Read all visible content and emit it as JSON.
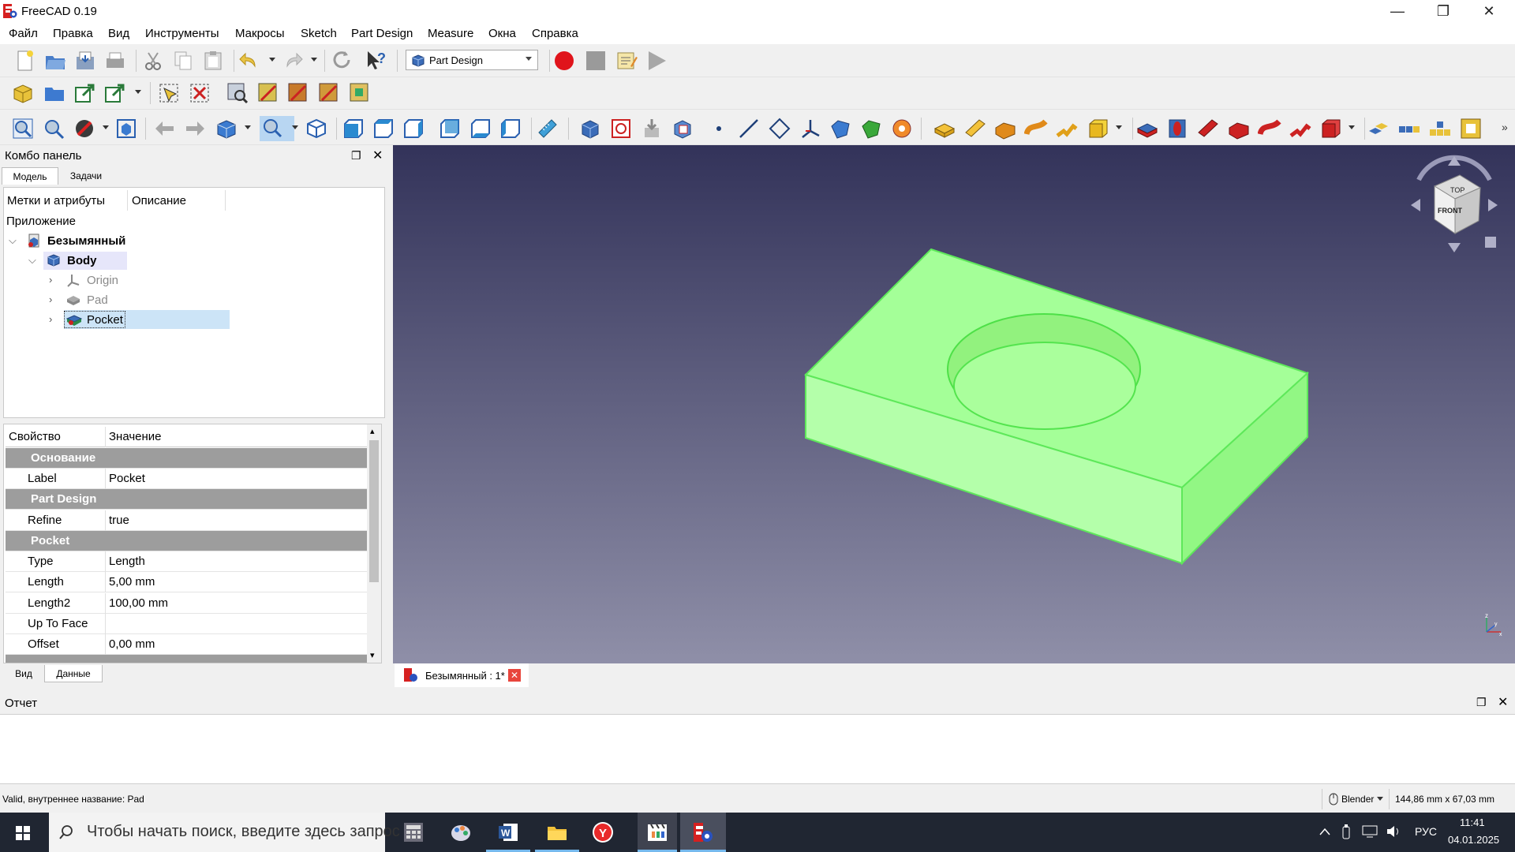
{
  "window": {
    "title": "FreeCAD 0.19",
    "minimize": "—",
    "restore": "❐",
    "close": "✕"
  },
  "menu": [
    "Файл",
    "Правка",
    "Вид",
    "Инструменты",
    "Макросы",
    "Sketch",
    "Part Design",
    "Measure",
    "Окна",
    "Справка"
  ],
  "toolbar": {
    "workbench_selected": "Part Design"
  },
  "combo": {
    "title": "Комбо панель",
    "tabs": [
      "Модель",
      "Задачи"
    ],
    "tree_headers": [
      "Метки и атрибуты",
      "Описание"
    ],
    "app_label": "Приложение",
    "tree": [
      {
        "label": "Безымянный",
        "icon": "document-icon"
      },
      {
        "label": "Body",
        "icon": "body-icon"
      },
      {
        "label": "Origin",
        "icon": "origin-icon"
      },
      {
        "label": "Pad",
        "icon": "pad-icon"
      },
      {
        "label": "Pocket",
        "icon": "pocket-icon"
      }
    ],
    "props_headers": [
      "Свойство",
      "Значение"
    ],
    "props": [
      {
        "group": "Основание"
      },
      {
        "key": "Label",
        "value": "Pocket"
      },
      {
        "group": "Part Design"
      },
      {
        "key": "Refine",
        "value": "true"
      },
      {
        "group": "Pocket"
      },
      {
        "key": "Type",
        "value": "Length"
      },
      {
        "key": "Length",
        "value": "5,00 mm"
      },
      {
        "key": "Length2",
        "value": "100,00 mm"
      },
      {
        "key": "Up To Face",
        "value": ""
      },
      {
        "key": "Offset",
        "value": "0,00 mm"
      }
    ],
    "bottom_tabs": [
      "Вид",
      "Данные"
    ]
  },
  "viewport": {
    "doc_tab": "Безымянный : 1*",
    "model_color": "#99ff99",
    "navcube_faces": [
      "TOP",
      "FRONT"
    ]
  },
  "report": {
    "title": "Отчет"
  },
  "status": {
    "message": "Valid, внутреннее название: Pad",
    "nav_style": "Blender",
    "dimensions": "144,86 mm x 67,03 mm"
  },
  "taskbar": {
    "search_placeholder": "Чтобы начать поиск, введите здесь запрос",
    "lang": "РУС",
    "time": "11:41",
    "date": "04.01.2025"
  }
}
